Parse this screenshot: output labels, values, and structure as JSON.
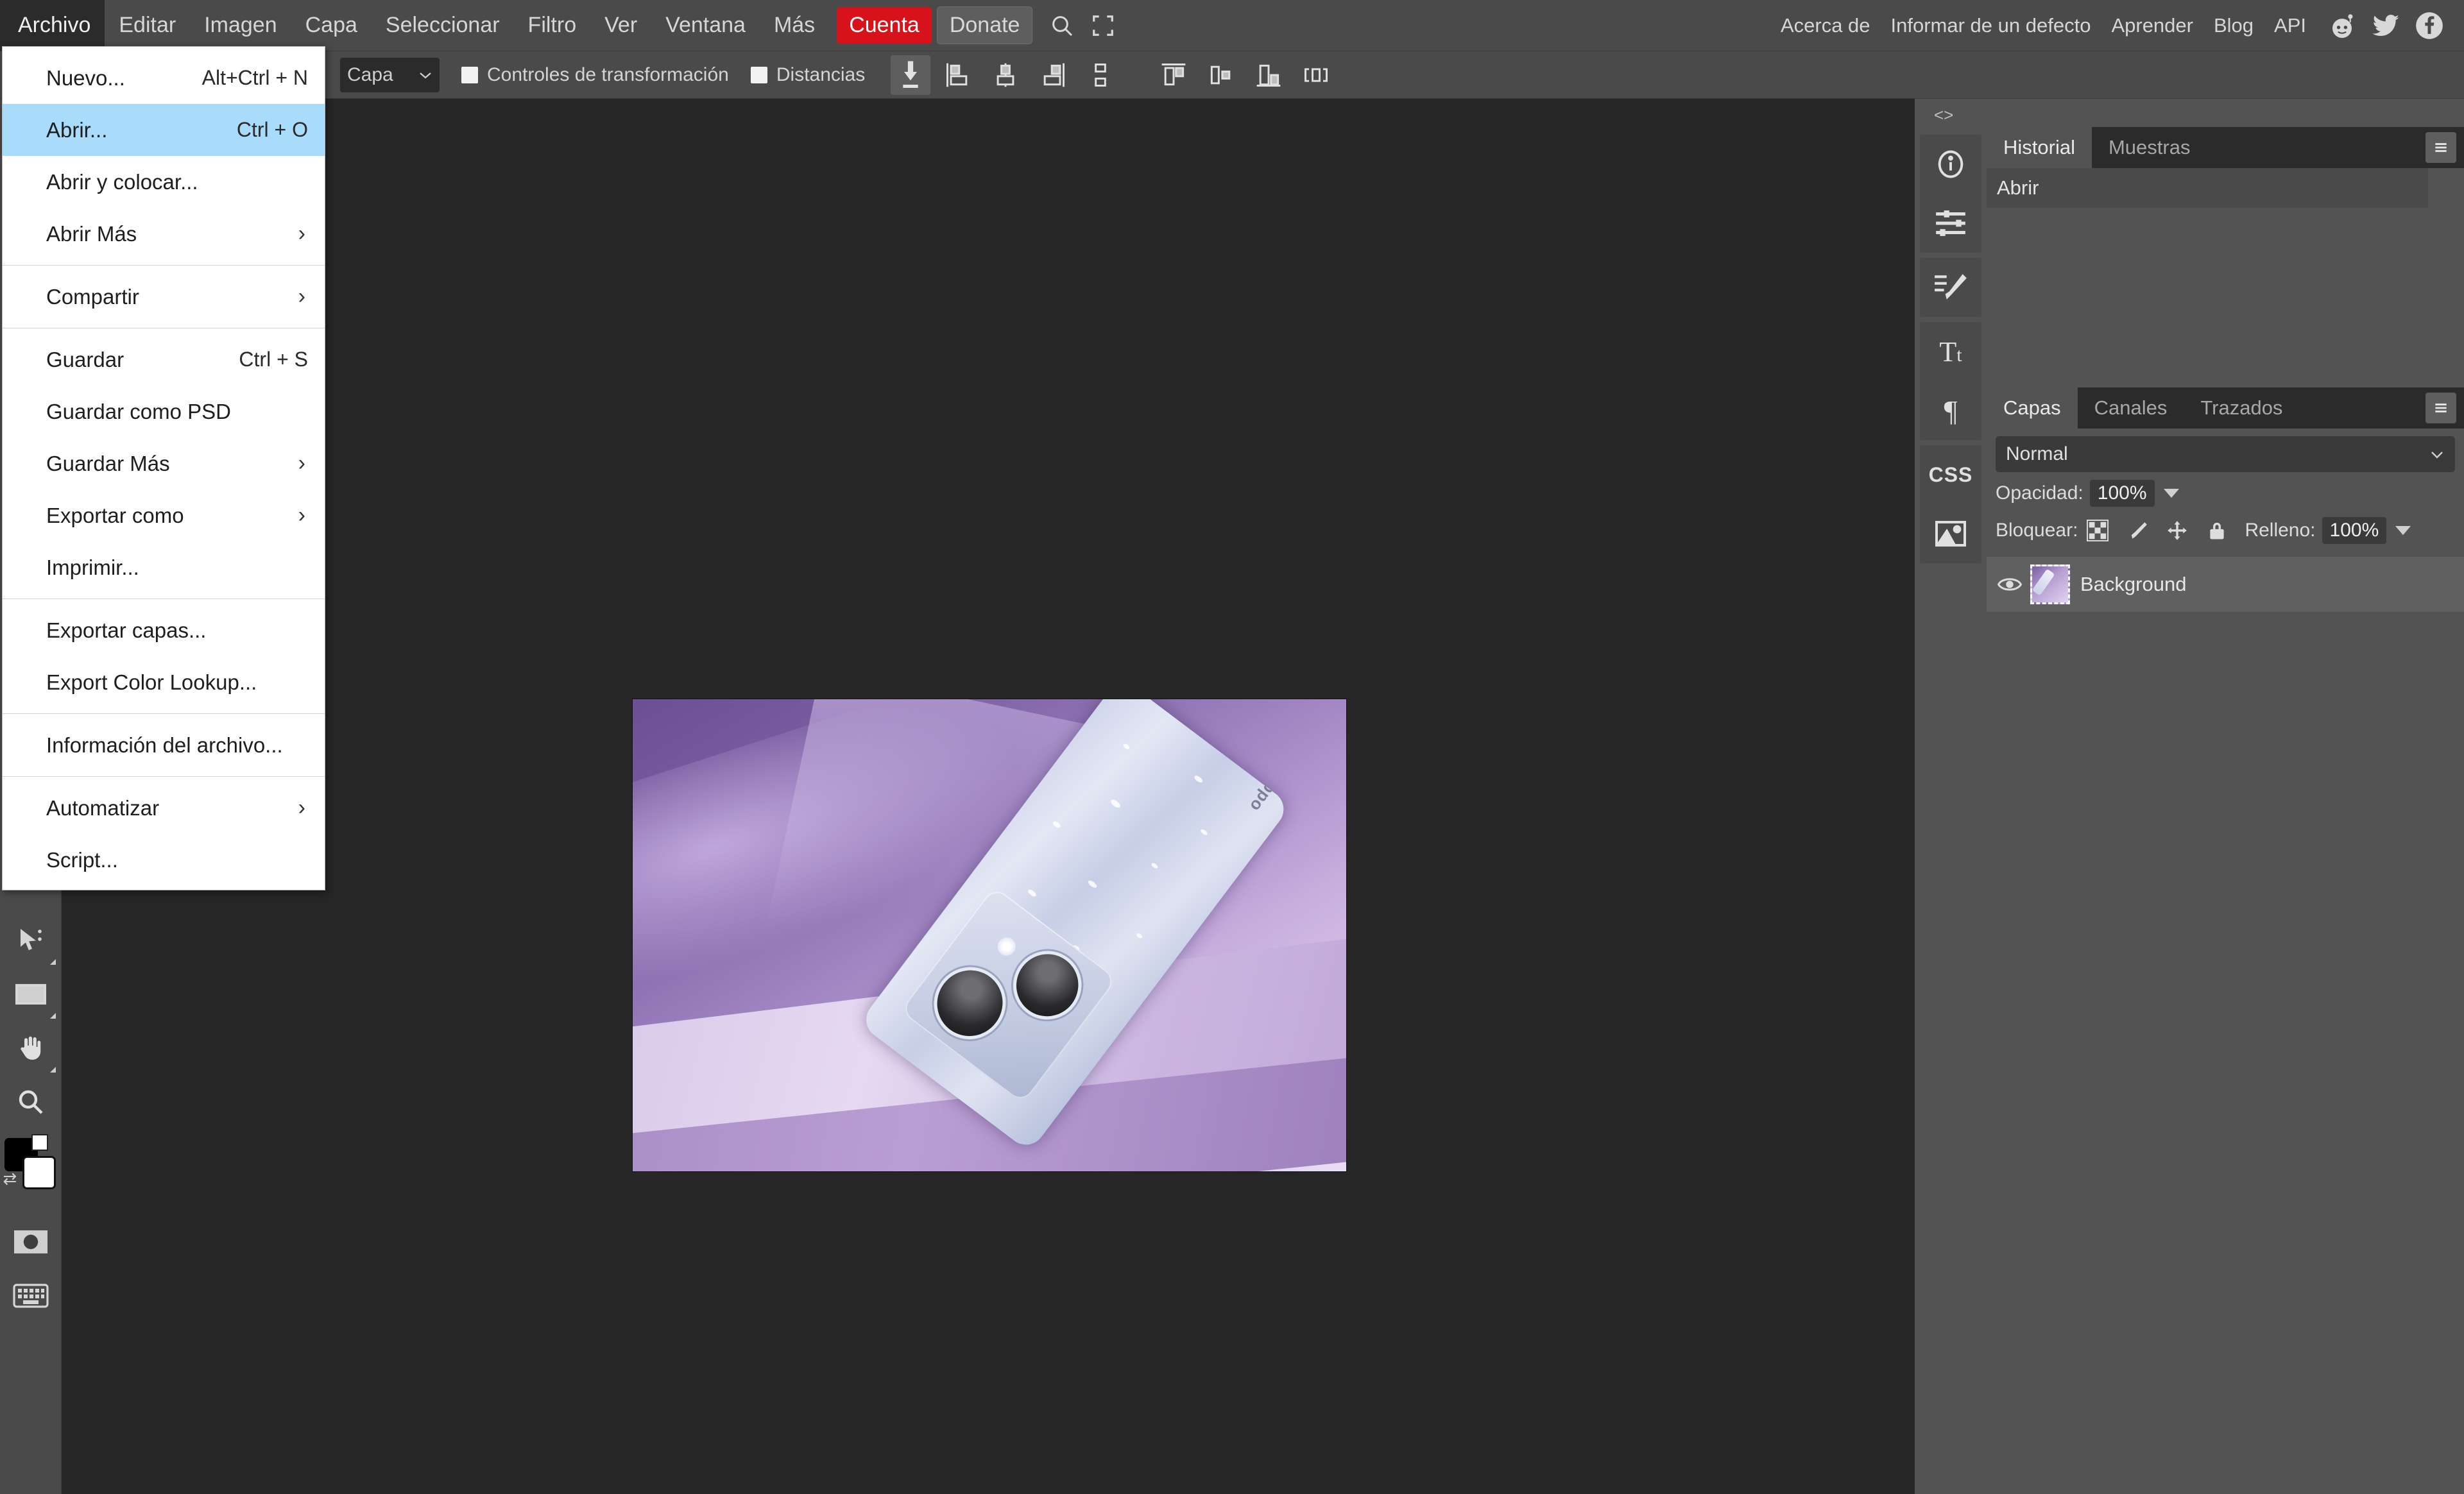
{
  "menubar": {
    "items": [
      {
        "label": "Archivo",
        "active": true
      },
      {
        "label": "Editar",
        "active": false
      },
      {
        "label": "Imagen",
        "active": false
      },
      {
        "label": "Capa",
        "active": false
      },
      {
        "label": "Seleccionar",
        "active": false
      },
      {
        "label": "Filtro",
        "active": false
      },
      {
        "label": "Ver",
        "active": false
      },
      {
        "label": "Ventana",
        "active": false
      },
      {
        "label": "Más",
        "active": false
      }
    ],
    "account_label": "Cuenta",
    "donate_label": "Donate",
    "search_icon": "search-icon",
    "fullscreen_icon": "fullscreen-icon",
    "right_links": [
      {
        "label": "Acerca de"
      },
      {
        "label": "Informar de un defecto"
      },
      {
        "label": "Aprender"
      },
      {
        "label": "Blog"
      },
      {
        "label": "API"
      }
    ],
    "social": [
      {
        "name": "reddit-icon"
      },
      {
        "name": "twitter-icon"
      },
      {
        "name": "facebook-icon"
      }
    ]
  },
  "file_menu": {
    "groups": [
      {
        "items": [
          {
            "label": "Nuevo...",
            "shortcut": "Alt+Ctrl + N",
            "submenu": false,
            "highlighted": false
          },
          {
            "label": "Abrir...",
            "shortcut": "Ctrl + O",
            "submenu": false,
            "highlighted": true
          },
          {
            "label": "Abrir y colocar...",
            "shortcut": "",
            "submenu": false,
            "highlighted": false
          },
          {
            "label": "Abrir Más",
            "shortcut": "",
            "submenu": true,
            "highlighted": false
          }
        ]
      },
      {
        "items": [
          {
            "label": "Compartir",
            "shortcut": "",
            "submenu": true,
            "highlighted": false
          }
        ]
      },
      {
        "items": [
          {
            "label": "Guardar",
            "shortcut": "Ctrl + S",
            "submenu": false,
            "highlighted": false
          },
          {
            "label": "Guardar como PSD",
            "shortcut": "",
            "submenu": false,
            "highlighted": false
          },
          {
            "label": "Guardar Más",
            "shortcut": "",
            "submenu": true,
            "highlighted": false
          },
          {
            "label": "Exportar como",
            "shortcut": "",
            "submenu": true,
            "highlighted": false
          },
          {
            "label": "Imprimir...",
            "shortcut": "",
            "submenu": false,
            "highlighted": false
          }
        ]
      },
      {
        "items": [
          {
            "label": "Exportar capas...",
            "shortcut": "",
            "submenu": false,
            "highlighted": false
          },
          {
            "label": "Export Color Lookup...",
            "shortcut": "",
            "submenu": false,
            "highlighted": false
          }
        ]
      },
      {
        "items": [
          {
            "label": "Información del archivo...",
            "shortcut": "",
            "submenu": false,
            "highlighted": false
          }
        ]
      },
      {
        "items": [
          {
            "label": "Automatizar",
            "shortcut": "",
            "submenu": true,
            "highlighted": false
          },
          {
            "label": "Script...",
            "shortcut": "",
            "submenu": false,
            "highlighted": false
          }
        ]
      }
    ]
  },
  "options_bar": {
    "target_select": "Capa",
    "transform_controls_label": "Controles de transformación",
    "transform_controls_checked": false,
    "distances_label": "Distancias",
    "distances_checked": false,
    "align_icons": [
      {
        "name": "auto-select-icon",
        "pressed": true
      },
      {
        "name": "align-left-edges-icon",
        "pressed": false
      },
      {
        "name": "align-horizontal-centers-icon",
        "pressed": false
      },
      {
        "name": "align-right-edges-icon",
        "pressed": false
      },
      {
        "name": "distribute-vertical-icon",
        "pressed": false
      },
      {
        "name": "align-top-edges-icon",
        "pressed": false
      },
      {
        "name": "align-vertical-centers-icon",
        "pressed": false
      },
      {
        "name": "align-bottom-edges-icon",
        "pressed": false
      },
      {
        "name": "distribute-horizontal-icon",
        "pressed": false
      }
    ]
  },
  "toolbar": {
    "tools": [
      {
        "name": "path-select-tool",
        "icon": "path-select-icon"
      },
      {
        "name": "shape-tool",
        "icon": "rectangle-icon"
      },
      {
        "name": "hand-tool",
        "icon": "hand-icon"
      },
      {
        "name": "zoom-tool",
        "icon": "magnifier-icon"
      }
    ],
    "foreground_color": "#000000",
    "background_color": "#ffffff",
    "extra": [
      {
        "name": "quick-mask-tool",
        "icon": "quick-mask-icon"
      },
      {
        "name": "keyboard-shortcuts-tool",
        "icon": "keyboard-icon"
      }
    ]
  },
  "right_dock": {
    "rail_icons": [
      {
        "name": "info-icon"
      },
      {
        "name": "adjustments-icon"
      },
      {
        "name": "brush-settings-icon"
      },
      {
        "name": "character-icon"
      },
      {
        "name": "paragraph-icon"
      },
      {
        "name": "css-icon"
      },
      {
        "name": "image-icon"
      }
    ],
    "collapse_left_label": "<>",
    "collapse_right_label": "><",
    "history_panel": {
      "tabs": [
        {
          "label": "Historial",
          "active": true
        },
        {
          "label": "Muestras",
          "active": false
        }
      ],
      "entries": [
        {
          "label": "Abrir",
          "selected": true
        }
      ],
      "menu_icon": "hamburger-icon"
    },
    "layers_panel": {
      "tabs": [
        {
          "label": "Capas",
          "active": true
        },
        {
          "label": "Canales",
          "active": false
        },
        {
          "label": "Trazados",
          "active": false
        }
      ],
      "menu_icon": "hamburger-icon",
      "blend_mode": "Normal",
      "opacity_label": "Opacidad:",
      "opacity_value": "100%",
      "lock_label": "Bloquear:",
      "lock_icons": [
        {
          "name": "lock-transparency-icon"
        },
        {
          "name": "lock-image-icon"
        },
        {
          "name": "lock-position-icon"
        },
        {
          "name": "lock-all-icon"
        }
      ],
      "fill_label": "Relleno:",
      "fill_value": "100%",
      "layers": [
        {
          "name": "Background",
          "visible": true,
          "selected": true
        }
      ]
    }
  },
  "canvas": {
    "document_alt": "oppo-phone-purple-product-photo",
    "phone_brand": "oppo"
  }
}
